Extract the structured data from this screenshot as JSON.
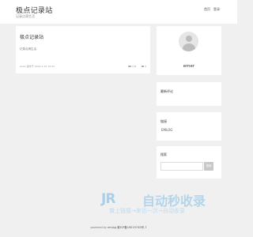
{
  "header": {
    "site_title": "极点记录站",
    "tagline": "记录点滴生活",
    "nav": [
      "首页",
      "登录"
    ]
  },
  "post": {
    "title": "极点记录站",
    "excerpt": "记录点滴生活",
    "meta": "emer 发布于 2022-2-15 12:33",
    "views": "121",
    "comments": "0"
  },
  "author": {
    "name": "emer"
  },
  "recent": {
    "title": "最新评论"
  },
  "links": {
    "title": "链接",
    "items": [
      "EMLOG"
    ]
  },
  "search": {
    "title": "搜索",
    "placeholder": "",
    "button_label": "搜索"
  },
  "watermark": {
    "logo": "JR",
    "title": "自动秒收录",
    "subtitle": "做上链接→来访一次→自动收录"
  },
  "footer": {
    "prefix": "powered by",
    "brand": "emlog",
    "icp": "冀ICP备19019745号-7"
  }
}
